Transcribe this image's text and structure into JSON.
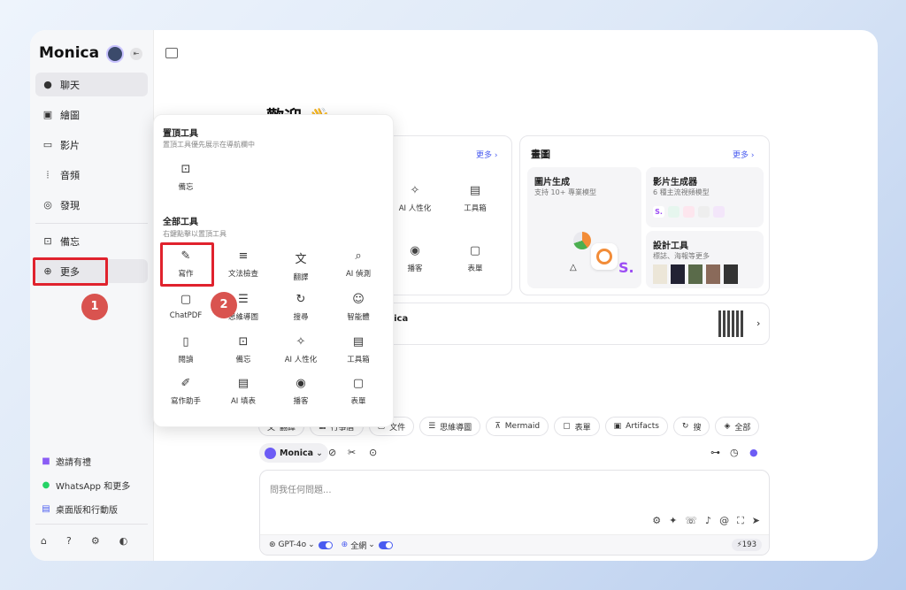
{
  "sidebar": {
    "brand": "Monica",
    "nav": [
      {
        "label": "聊天",
        "icon": "chat-icon"
      },
      {
        "label": "繪圖",
        "icon": "image-icon"
      },
      {
        "label": "影片",
        "icon": "video-icon"
      },
      {
        "label": "音頻",
        "icon": "audio-icon"
      },
      {
        "label": "發現",
        "icon": "compass-icon"
      },
      {
        "label": "備忘",
        "icon": "memo-icon"
      },
      {
        "label": "更多",
        "icon": "plus-circle-icon"
      }
    ],
    "footer": [
      {
        "label": "邀請有禮",
        "icon": "gift-icon"
      },
      {
        "label": "WhatsApp 和更多",
        "icon": "whatsapp-icon"
      },
      {
        "label": "桌面版和行動版",
        "icon": "desktop-icon"
      }
    ]
  },
  "annotations": {
    "step1": "1",
    "step2": "2"
  },
  "main": {
    "welcome": "歡迎 👋",
    "tools_card": {
      "more": "更多 ›",
      "tiles": [
        "AI 人性化",
        "工具箱",
        "播客",
        "表單"
      ]
    },
    "paint_card": {
      "title": "畫圖",
      "more": "更多 ›",
      "sub1": {
        "title": "圖片生成",
        "desc": "支持 10+ 專業模型"
      },
      "sub2": {
        "title": "影片生成器",
        "desc": "6 種主流視頻模型"
      },
      "sub3": {
        "title": "設計工具",
        "desc": "標誌、海報等更多"
      }
    },
    "banner_text": "nica",
    "chips": [
      "翻譯",
      "行事曆",
      "文件",
      "思維導圖",
      "Mermaid",
      "表單",
      "Artifacts",
      "搜",
      "全部"
    ],
    "model": "Monica",
    "input_placeholder": "問我任何問題...",
    "footer_model": "GPT-4o",
    "footer_web": "全網",
    "credits": "193"
  },
  "popup": {
    "pinned_title": "置頂工具",
    "pinned_desc": "置頂工具優先展示在導航欄中",
    "pinned_items": [
      {
        "label": "備忘",
        "icon": "memo-icon"
      }
    ],
    "all_title": "全部工具",
    "all_desc": "右鍵點擊以置頂工具",
    "tools": [
      {
        "label": "寫作",
        "icon": "pen-icon"
      },
      {
        "label": "文法檢查",
        "icon": "grammar-icon"
      },
      {
        "label": "翻譯",
        "icon": "translate-icon"
      },
      {
        "label": "AI 偵測",
        "icon": "detect-icon"
      },
      {
        "label": "ChatPDF",
        "icon": "pdf-icon"
      },
      {
        "label": "思維導圖",
        "icon": "mindmap-icon"
      },
      {
        "label": "搜尋",
        "icon": "search-icon"
      },
      {
        "label": "智能體",
        "icon": "bot-icon"
      },
      {
        "label": "閱讀",
        "icon": "book-icon"
      },
      {
        "label": "備忘",
        "icon": "memo-icon"
      },
      {
        "label": "AI 人性化",
        "icon": "humanize-icon"
      },
      {
        "label": "工具箱",
        "icon": "toolbox-icon"
      },
      {
        "label": "寫作助手",
        "icon": "writing-assistant-icon"
      },
      {
        "label": "AI 填表",
        "icon": "form-fill-icon"
      },
      {
        "label": "播客",
        "icon": "podcast-icon"
      },
      {
        "label": "表單",
        "icon": "form-icon"
      }
    ]
  },
  "colors": {
    "accent": "#4a5cf0",
    "highlight": "#e0222d",
    "badge": "#d9534f"
  }
}
